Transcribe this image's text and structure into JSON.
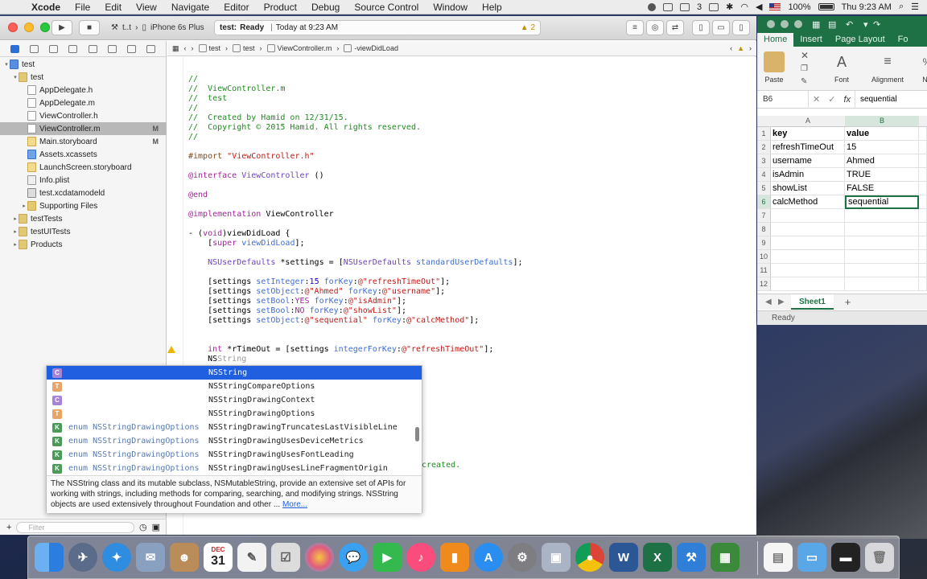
{
  "menubar": {
    "app": "Xcode",
    "items": [
      "File",
      "Edit",
      "View",
      "Navigate",
      "Editor",
      "Product",
      "Debug",
      "Source Control",
      "Window",
      "Help"
    ],
    "battery": "100%",
    "clock": "Thu 9:23 AM",
    "notifications_count": "3"
  },
  "xcode_toolbar": {
    "scheme_target": "t..t",
    "scheme_device": "iPhone 6s Plus",
    "status_project": "test:",
    "status_state": "Ready",
    "status_time": "Today at 9:23 AM",
    "warning_count": "2"
  },
  "navigator": {
    "items": [
      {
        "label": "test",
        "kind": "proj",
        "depth": 0,
        "badge": "",
        "tri": "▾"
      },
      {
        "label": "test",
        "kind": "folder",
        "depth": 1,
        "badge": "",
        "tri": "▾"
      },
      {
        "label": "AppDelegate.h",
        "kind": "h",
        "depth": 2,
        "badge": "",
        "tri": ""
      },
      {
        "label": "AppDelegate.m",
        "kind": "m",
        "depth": 2,
        "badge": "",
        "tri": ""
      },
      {
        "label": "ViewController.h",
        "kind": "h",
        "depth": 2,
        "badge": "",
        "tri": ""
      },
      {
        "label": "ViewController.m",
        "kind": "m",
        "depth": 2,
        "badge": "M",
        "tri": "",
        "selected": true
      },
      {
        "label": "Main.storyboard",
        "kind": "sb",
        "depth": 2,
        "badge": "M",
        "tri": ""
      },
      {
        "label": "Assets.xcassets",
        "kind": "assets",
        "depth": 2,
        "badge": "",
        "tri": ""
      },
      {
        "label": "LaunchScreen.storyboard",
        "kind": "sb",
        "depth": 2,
        "badge": "",
        "tri": ""
      },
      {
        "label": "Info.plist",
        "kind": "plist",
        "depth": 2,
        "badge": "",
        "tri": ""
      },
      {
        "label": "test.xcdatamodeld",
        "kind": "model",
        "depth": 2,
        "badge": "",
        "tri": ""
      },
      {
        "label": "Supporting Files",
        "kind": "folder",
        "depth": 2,
        "badge": "",
        "tri": "▸"
      },
      {
        "label": "testTests",
        "kind": "folder",
        "depth": 1,
        "badge": "",
        "tri": "▸"
      },
      {
        "label": "testUITests",
        "kind": "folder",
        "depth": 1,
        "badge": "",
        "tri": "▸"
      },
      {
        "label": "Products",
        "kind": "folder",
        "depth": 1,
        "badge": "",
        "tri": "▸"
      }
    ],
    "filter_placeholder": "Filter"
  },
  "jumpbar": {
    "crumbs": [
      "test",
      "test",
      "ViewController.m",
      "-viewDidLoad"
    ]
  },
  "code_lines": [
    [
      {
        "t": "//",
        "c": "cm"
      }
    ],
    [
      {
        "t": "//  ViewController.m",
        "c": "cm"
      }
    ],
    [
      {
        "t": "//  test",
        "c": "cm"
      }
    ],
    [
      {
        "t": "//",
        "c": "cm"
      }
    ],
    [
      {
        "t": "//  Created by Hamid on 12/31/15.",
        "c": "cm"
      }
    ],
    [
      {
        "t": "//  Copyright © 2015 Hamid. All rights reserved.",
        "c": "cm"
      }
    ],
    [
      {
        "t": "//",
        "c": "cm"
      }
    ],
    [],
    [
      {
        "t": "#import ",
        "c": "pp"
      },
      {
        "t": "\"ViewController.h\"",
        "c": "str"
      }
    ],
    [],
    [
      {
        "t": "@interface ",
        "c": "kw"
      },
      {
        "t": "ViewController",
        "c": "cls"
      },
      {
        "t": " ()",
        "c": ""
      }
    ],
    [],
    [
      {
        "t": "@end",
        "c": "kw"
      }
    ],
    [],
    [
      {
        "t": "@implementation ",
        "c": "kw"
      },
      {
        "t": "ViewController",
        "c": ""
      }
    ],
    [],
    [
      {
        "t": "- (",
        "c": ""
      },
      {
        "t": "void",
        "c": "kw"
      },
      {
        "t": ")viewDidLoad {",
        "c": ""
      }
    ],
    [
      {
        "t": "    [",
        "c": ""
      },
      {
        "t": "super",
        "c": "kw"
      },
      {
        "t": " ",
        "c": ""
      },
      {
        "t": "viewDidLoad",
        "c": "mt"
      },
      {
        "t": "];",
        "c": ""
      }
    ],
    [],
    [
      {
        "t": "    ",
        "c": ""
      },
      {
        "t": "NSUserDefaults",
        "c": "cls"
      },
      {
        "t": " *settings = [",
        "c": ""
      },
      {
        "t": "NSUserDefaults",
        "c": "cls"
      },
      {
        "t": " ",
        "c": ""
      },
      {
        "t": "standardUserDefaults",
        "c": "mt"
      },
      {
        "t": "];",
        "c": ""
      }
    ],
    [],
    [
      {
        "t": "    [settings ",
        "c": ""
      },
      {
        "t": "setInteger",
        "c": "mt"
      },
      {
        "t": ":",
        "c": ""
      },
      {
        "t": "15",
        "c": "num"
      },
      {
        "t": " ",
        "c": ""
      },
      {
        "t": "forKey",
        "c": "mt"
      },
      {
        "t": ":",
        "c": ""
      },
      {
        "t": "@\"refreshTimeOut\"",
        "c": "str"
      },
      {
        "t": "];",
        "c": ""
      }
    ],
    [
      {
        "t": "    [settings ",
        "c": ""
      },
      {
        "t": "setObject",
        "c": "mt"
      },
      {
        "t": ":",
        "c": ""
      },
      {
        "t": "@\"Ahmed\"",
        "c": "str"
      },
      {
        "t": " ",
        "c": ""
      },
      {
        "t": "forKey",
        "c": "mt"
      },
      {
        "t": ":",
        "c": ""
      },
      {
        "t": "@\"username\"",
        "c": "str"
      },
      {
        "t": "];",
        "c": ""
      }
    ],
    [
      {
        "t": "    [settings ",
        "c": ""
      },
      {
        "t": "setBool",
        "c": "mt"
      },
      {
        "t": ":",
        "c": ""
      },
      {
        "t": "YES",
        "c": "kw"
      },
      {
        "t": " ",
        "c": ""
      },
      {
        "t": "forKey",
        "c": "mt"
      },
      {
        "t": ":",
        "c": ""
      },
      {
        "t": "@\"isAdmin\"",
        "c": "str"
      },
      {
        "t": "];",
        "c": ""
      }
    ],
    [
      {
        "t": "    [settings ",
        "c": ""
      },
      {
        "t": "setBool",
        "c": "mt"
      },
      {
        "t": ":",
        "c": ""
      },
      {
        "t": "NO",
        "c": "kw"
      },
      {
        "t": " ",
        "c": ""
      },
      {
        "t": "forKey",
        "c": "mt"
      },
      {
        "t": ":",
        "c": ""
      },
      {
        "t": "@\"showList\"",
        "c": "str"
      },
      {
        "t": "];",
        "c": ""
      }
    ],
    [
      {
        "t": "    [settings ",
        "c": ""
      },
      {
        "t": "setObject",
        "c": "mt"
      },
      {
        "t": ":",
        "c": ""
      },
      {
        "t": "@\"sequential\"",
        "c": "str"
      },
      {
        "t": " ",
        "c": ""
      },
      {
        "t": "forKey",
        "c": "mt"
      },
      {
        "t": ":",
        "c": ""
      },
      {
        "t": "@\"calcMethod\"",
        "c": "str"
      },
      {
        "t": "];",
        "c": ""
      }
    ],
    [],
    [],
    [
      {
        "t": "    ",
        "c": ""
      },
      {
        "t": "int",
        "c": "kw"
      },
      {
        "t": " *rTimeOut = [settings ",
        "c": ""
      },
      {
        "t": "integerForKey",
        "c": "mt"
      },
      {
        "t": ":",
        "c": ""
      },
      {
        "t": "@\"refreshTimeOut\"",
        "c": "str"
      },
      {
        "t": "];",
        "c": ""
      }
    ],
    [
      {
        "t": "    NS",
        "c": ""
      },
      {
        "t": "String",
        "c": "ghost"
      }
    ]
  ],
  "code_tail": "created.",
  "completion": {
    "items": [
      {
        "kind": "C",
        "ret": "",
        "name": "NSString",
        "selected": true
      },
      {
        "kind": "T",
        "ret": "",
        "name": "NSStringCompareOptions"
      },
      {
        "kind": "C",
        "ret": "",
        "name": "NSStringDrawingContext"
      },
      {
        "kind": "T",
        "ret": "",
        "name": "NSStringDrawingOptions"
      },
      {
        "kind": "K",
        "ret": "enum NSStringDrawingOptions",
        "name": "NSStringDrawingTruncatesLastVisibleLine"
      },
      {
        "kind": "K",
        "ret": "enum NSStringDrawingOptions",
        "name": "NSStringDrawingUsesDeviceMetrics"
      },
      {
        "kind": "K",
        "ret": "enum NSStringDrawingOptions",
        "name": "NSStringDrawingUsesFontLeading"
      },
      {
        "kind": "K",
        "ret": "enum NSStringDrawingOptions",
        "name": "NSStringDrawingUsesLineFragmentOrigin"
      }
    ],
    "description": "The NSString class and its mutable subclass, NSMutableString, provide an extensive set of APIs for working with strings, including methods for comparing, searching, and modifying strings. NSString objects are used extensively throughout Foundation and other ...",
    "more_link": "More..."
  },
  "excel": {
    "tabs": [
      "Home",
      "Insert",
      "Page Layout",
      "Fo"
    ],
    "ribbon": [
      "Paste",
      "Font",
      "Alignment",
      "Nu"
    ],
    "name_box": "B6",
    "fx_label": "fx",
    "formula_value": "sequential",
    "columns": [
      "A",
      "B"
    ],
    "rows": [
      {
        "n": "1",
        "a": "key",
        "b": "value",
        "bold": true
      },
      {
        "n": "2",
        "a": "refreshTimeOut",
        "b": "15"
      },
      {
        "n": "3",
        "a": "username",
        "b": "Ahmed"
      },
      {
        "n": "4",
        "a": "isAdmin",
        "b": "TRUE"
      },
      {
        "n": "5",
        "a": "showList",
        "b": "FALSE"
      },
      {
        "n": "6",
        "a": "calcMethod",
        "b": "sequential",
        "active": true
      },
      {
        "n": "7",
        "a": "",
        "b": ""
      },
      {
        "n": "8",
        "a": "",
        "b": ""
      },
      {
        "n": "9",
        "a": "",
        "b": ""
      },
      {
        "n": "10",
        "a": "",
        "b": ""
      },
      {
        "n": "11",
        "a": "",
        "b": ""
      },
      {
        "n": "12",
        "a": "",
        "b": ""
      }
    ],
    "sheet_tab": "Sheet1",
    "add_sheet": "+",
    "status": "Ready"
  },
  "dock": {
    "calendar_month": "DEC",
    "calendar_day": "31",
    "excel_letter": "X",
    "word_letter": "W"
  },
  "colors": {
    "xcode_selection": "#1f5fe0",
    "excel_green": "#1e7145"
  }
}
